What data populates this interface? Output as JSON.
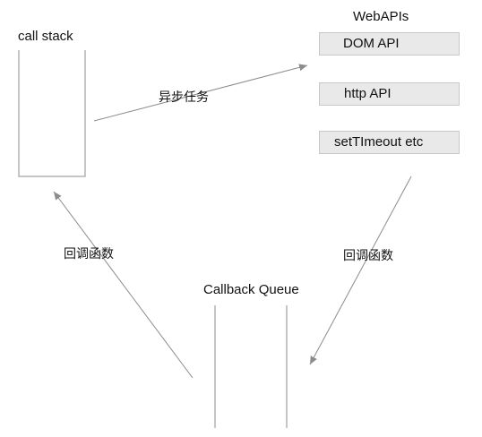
{
  "call_stack": {
    "label": "call stack"
  },
  "web_apis": {
    "title": "WebAPIs",
    "items": [
      {
        "label": "DOM API"
      },
      {
        "label": "http API"
      },
      {
        "label": "setTImeout etc"
      }
    ]
  },
  "callback_queue": {
    "label": "Callback Queue"
  },
  "edges": {
    "async_task": "异步任务",
    "callback_left": "回调函数",
    "callback_right": "回调函数"
  },
  "colors": {
    "line": "#8c8c8c",
    "box_fill": "#e9e9e9",
    "box_border": "#c9c9c9",
    "text": "#111111"
  }
}
